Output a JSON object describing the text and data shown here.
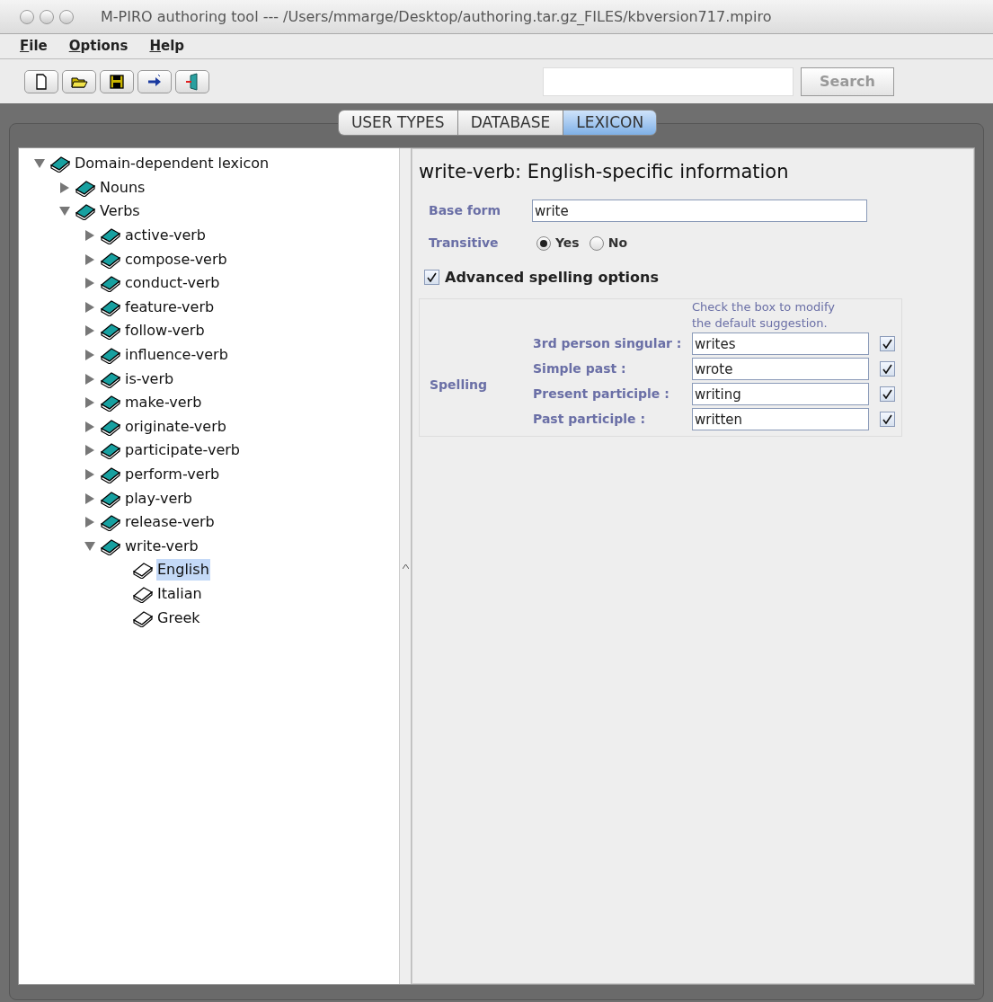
{
  "window": {
    "title": "M-PIRO authoring tool --- /Users/mmarge/Desktop/authoring.tar.gz_FILES/kbversion717.mpiro"
  },
  "menu": [
    {
      "label": "File"
    },
    {
      "label": "Options"
    },
    {
      "label": "Help"
    }
  ],
  "toolbar": [
    {
      "kind": "new"
    },
    {
      "kind": "open"
    },
    {
      "kind": "save"
    },
    {
      "kind": "export"
    },
    {
      "kind": "exit"
    }
  ],
  "search": {
    "button": "Search"
  },
  "tabs": [
    {
      "label": "USER TYPES",
      "selected": false
    },
    {
      "label": "DATABASE",
      "selected": false
    },
    {
      "label": "LEXICON",
      "selected": true
    }
  ],
  "tree": [
    {
      "label": "Domain-dependent lexicon",
      "expanded": true,
      "selected": false,
      "children": [
        {
          "label": "Nouns",
          "expanded": false,
          "selected": false
        },
        {
          "label": "Verbs",
          "expanded": true,
          "selected": false,
          "children": [
            {
              "label": "active-verb",
              "expanded": false,
              "selected": false
            },
            {
              "label": "compose-verb",
              "expanded": false,
              "selected": false
            },
            {
              "label": "conduct-verb",
              "expanded": false,
              "selected": false
            },
            {
              "label": "feature-verb",
              "expanded": false,
              "selected": false
            },
            {
              "label": "follow-verb",
              "expanded": false,
              "selected": false
            },
            {
              "label": "influence-verb",
              "expanded": false,
              "selected": false
            },
            {
              "label": "is-verb",
              "expanded": false,
              "selected": false
            },
            {
              "label": "make-verb",
              "expanded": false,
              "selected": false
            },
            {
              "label": "originate-verb",
              "expanded": false,
              "selected": false
            },
            {
              "label": "participate-verb",
              "expanded": false,
              "selected": false
            },
            {
              "label": "perform-verb",
              "expanded": false,
              "selected": false
            },
            {
              "label": "play-verb",
              "expanded": false,
              "selected": false
            },
            {
              "label": "release-verb",
              "expanded": false,
              "selected": false
            },
            {
              "label": "write-verb",
              "expanded": true,
              "selected": false,
              "children": [
                {
                  "label": "English",
                  "kind": "leaf",
                  "selected": true
                },
                {
                  "label": "Italian",
                  "kind": "leaf",
                  "selected": false
                },
                {
                  "label": "Greek",
                  "kind": "leaf",
                  "selected": false
                }
              ]
            }
          ]
        }
      ]
    }
  ],
  "detail": {
    "heading": "write-verb: English-specific information",
    "base_form": {
      "label": "Base form",
      "value": "write"
    },
    "transitive": {
      "label": "Transitive",
      "options": [
        {
          "label": "Yes",
          "selected": true
        },
        {
          "label": "No",
          "selected": false
        }
      ]
    },
    "advanced": {
      "label": "Advanced spelling options",
      "checked": true
    },
    "spelling": {
      "label": "Spelling",
      "hint": "Check the box to modify the default suggestion.",
      "rows": [
        {
          "label": "3rd person singular :",
          "value": "writes",
          "checked": true
        },
        {
          "label": "Simple past :",
          "value": "wrote",
          "checked": true
        },
        {
          "label": "Present participle :",
          "value": "writing",
          "checked": true
        },
        {
          "label": "Past participle :",
          "value": "written",
          "checked": true
        }
      ]
    }
  }
}
